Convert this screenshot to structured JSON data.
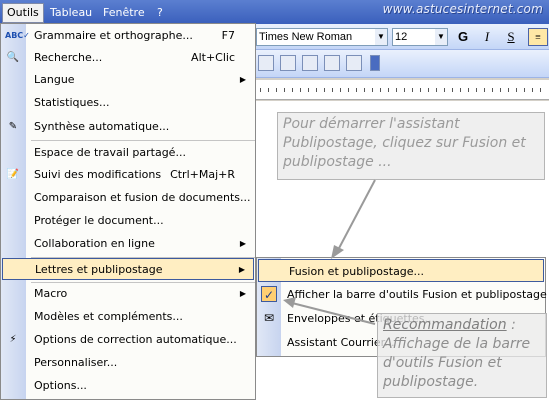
{
  "menubar": {
    "items": [
      {
        "label": "Outils",
        "active": true
      },
      {
        "label": "Tableau",
        "active": false
      },
      {
        "label": "Fenêtre",
        "active": false
      },
      {
        "label": "?",
        "active": false
      }
    ],
    "watermark": "www.astucesinternet.com"
  },
  "toolbar": {
    "font_name": "Times New Roman",
    "font_size": "12",
    "bold": "G",
    "italic": "I",
    "underline": "S"
  },
  "menu": {
    "items": [
      {
        "label": "Grammaire et orthographe...",
        "shortcut": "F7",
        "icon": "spelling-icon"
      },
      {
        "label": "Recherche...",
        "shortcut": "Alt+Clic",
        "icon": "research-icon"
      },
      {
        "label": "Langue",
        "submenu": true
      },
      {
        "label": "Statistiques..."
      },
      {
        "label": "Synthèse automatique...",
        "icon": "autosummarize-icon"
      },
      {
        "label": "Espace de travail partagé..."
      },
      {
        "label": "Suivi des modifications",
        "shortcut": "Ctrl+Maj+R",
        "icon": "track-changes-icon"
      },
      {
        "label": "Comparaison et fusion de documents..."
      },
      {
        "label": "Protéger le document..."
      },
      {
        "label": "Collaboration en ligne",
        "submenu": true
      },
      {
        "label": "Lettres et publipostage",
        "submenu": true,
        "highlighted": true
      },
      {
        "label": "Macro",
        "submenu": true
      },
      {
        "label": "Modèles et compléments..."
      },
      {
        "label": "Options de correction automatique...",
        "icon": "autocorrect-icon"
      },
      {
        "label": "Personnaliser..."
      },
      {
        "label": "Options..."
      }
    ]
  },
  "submenu": {
    "items": [
      {
        "label": "Fusion et publipostage...",
        "highlighted": true
      },
      {
        "label": "Afficher la barre d'outils Fusion et publipostage",
        "checked": true
      },
      {
        "label": "Enveloppes et étiquettes...",
        "icon": "envelope-icon"
      },
      {
        "label": "Assistant Courrier..."
      }
    ]
  },
  "callouts": {
    "first": "Pour démarrer l'assistant Publipostage, cliquez sur Fusion et publipostage ...",
    "second_head": "Recommandation",
    "second_colon": " :",
    "second_body": "Affichage de la barre d'outils Fusion et publipostage."
  }
}
